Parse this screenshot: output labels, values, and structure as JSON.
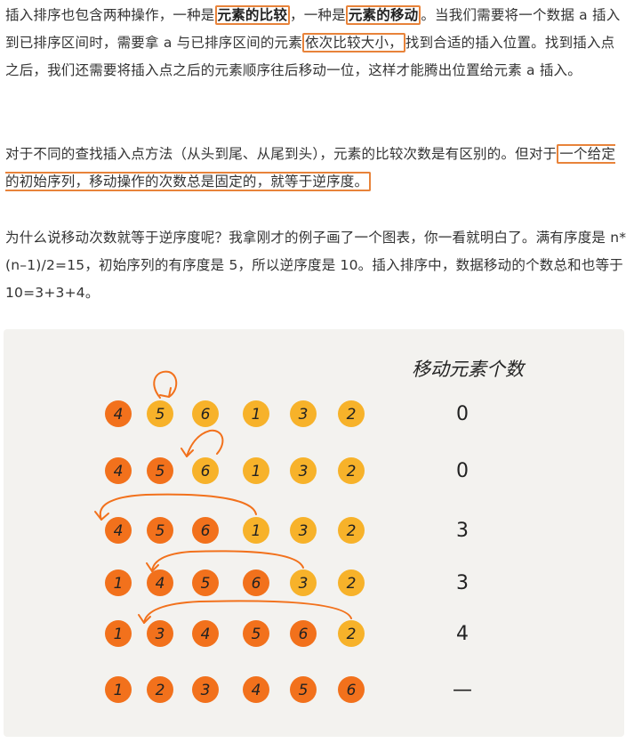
{
  "paragraphs": [
    {
      "before": "插入排序也包含两种操作，一种是",
      "h1": "元素的比较",
      "mid1": "，一种是",
      "h2": "元素的移动",
      "mid2": "。当我们需要将一个数据 a 插入到已排序区间时，需要拿 a 与已排序区间的元素",
      "h3": "依次比较大小，",
      "after": "找到合适的插入位置。找到插入点之后，我们还需要将插入点之后的元素顺序往后移动一位，这样才能腾出位置给元素 a 插入。"
    },
    {
      "before": "对于不同的查找插入点方法（从头到尾、从尾到头），元素的比较次数是有区别的。但对于",
      "h1": "一个给定的初始序列，移动操作的次数总是固定的，就等于逆序度。"
    },
    {
      "text": "为什么说移动次数就等于逆序度呢？我拿刚才的例子画了一个图表，你一看就明白了。满有序度是 n*(n–1)/2=15，初始序列的有序度是 5，所以逆序度是 10。插入排序中，数据移动的个数总和也等于 10=3+3+4。"
    }
  ],
  "figure": {
    "header": "移动元素个数",
    "rows": [
      {
        "values": [
          "4",
          "5",
          "6",
          "1",
          "3",
          "2"
        ],
        "sorted": 1,
        "moves": "0"
      },
      {
        "values": [
          "4",
          "5",
          "6",
          "1",
          "3",
          "2"
        ],
        "sorted": 2,
        "moves": "0"
      },
      {
        "values": [
          "4",
          "5",
          "6",
          "1",
          "3",
          "2"
        ],
        "sorted": 3,
        "moves": "3"
      },
      {
        "values": [
          "1",
          "4",
          "5",
          "6",
          "3",
          "2"
        ],
        "sorted": 4,
        "moves": "3"
      },
      {
        "values": [
          "1",
          "3",
          "4",
          "5",
          "6",
          "2"
        ],
        "sorted": 5,
        "moves": "4"
      },
      {
        "values": [
          "1",
          "2",
          "3",
          "4",
          "5",
          "6"
        ],
        "sorted": 6,
        "moves": "—"
      }
    ],
    "colors": {
      "sorted": "#f2711c",
      "unsorted": "#f7b22a",
      "text": "#222222",
      "arrow": "#f2711c",
      "figure_bg": "#f3f2ef"
    }
  }
}
